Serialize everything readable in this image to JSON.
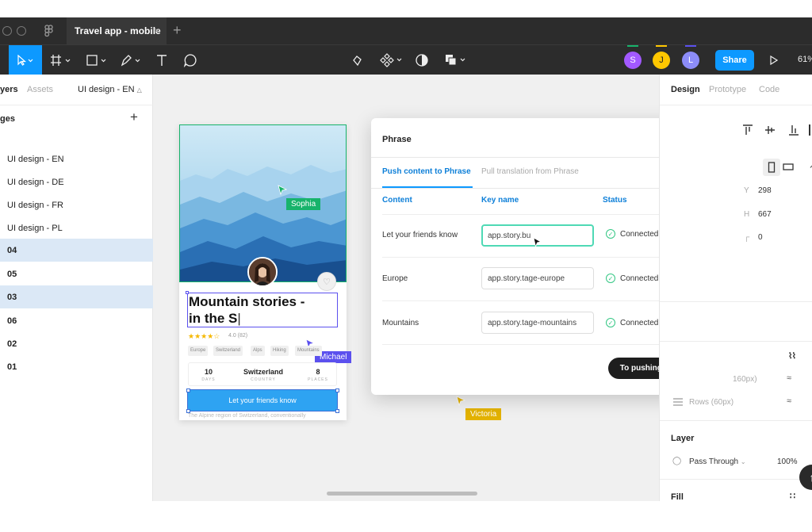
{
  "window": {
    "tab_title": "Travel app - mobile",
    "tab_close": "×",
    "new_tab": "+"
  },
  "toolbar": {
    "share_label": "Share",
    "zoom": "61%",
    "collaborators": [
      {
        "initial": "S",
        "color": "#a259ff"
      },
      {
        "initial": "J",
        "color": "#ffc700"
      },
      {
        "initial": "L",
        "color": "#8c8cf7"
      }
    ]
  },
  "left_panel": {
    "tab_layers": "yers",
    "tab_assets": "Assets",
    "page_selector": "UI design - EN",
    "pages_header": "ges",
    "add_page": "+",
    "items": [
      {
        "label": "UI design - EN"
      },
      {
        "label": "UI design - DE"
      },
      {
        "label": "UI design - FR"
      },
      {
        "label": "UI design - PL"
      },
      {
        "label": "04"
      },
      {
        "label": "05"
      },
      {
        "label": "03"
      },
      {
        "label": "06"
      },
      {
        "label": "02"
      },
      {
        "label": "01"
      }
    ]
  },
  "frame": {
    "title_line1": "Mountain stories -",
    "title_line2": "in the S",
    "stars": "★★★★☆",
    "rating": "4.0 (82)",
    "chips": [
      "Europe",
      "Switzerland",
      "Alps",
      "Hiking",
      "Mountains"
    ],
    "stats": [
      {
        "value": "10",
        "label": "DAYS"
      },
      {
        "value": "Switzerland",
        "label": "COUNTRY"
      },
      {
        "value": "8",
        "label": "PLACES"
      }
    ],
    "cta": "Let your friends know",
    "description": "The Alpine region of Switzerland, conventionally"
  },
  "cursors": {
    "sophia": "Sophia",
    "michael": "Michael",
    "victoria": "Victoria"
  },
  "dialog": {
    "title": "Phrase",
    "tabs": [
      "Push content to Phrase",
      "Pull translation from Phrase"
    ],
    "columns": [
      "Content",
      "Key name",
      "Status"
    ],
    "rows": [
      {
        "content": "Let your friends know",
        "key": "app.story.bu",
        "status": "Connected with Phrase"
      },
      {
        "content": "Europe",
        "key": "app.story.tage-europe",
        "status": "Connected with Phrase"
      },
      {
        "content": "Mountains",
        "key": "app.story.tage-mountains",
        "status": "Connected with Phrase"
      }
    ],
    "remove": "×",
    "button": "To pushing confirmation"
  },
  "right_panel": {
    "tabs": [
      "Design",
      "Prototype",
      "Code"
    ],
    "y_label": "Y",
    "y_value": "298",
    "h_label": "H",
    "h_value": "667",
    "radius_value": "0",
    "grid_cols": "160px)",
    "grid_rows": "Rows (60px)",
    "layer_header": "Layer",
    "blend_mode": "Pass Through",
    "opacity": "100%",
    "fill_header": "Fill"
  }
}
